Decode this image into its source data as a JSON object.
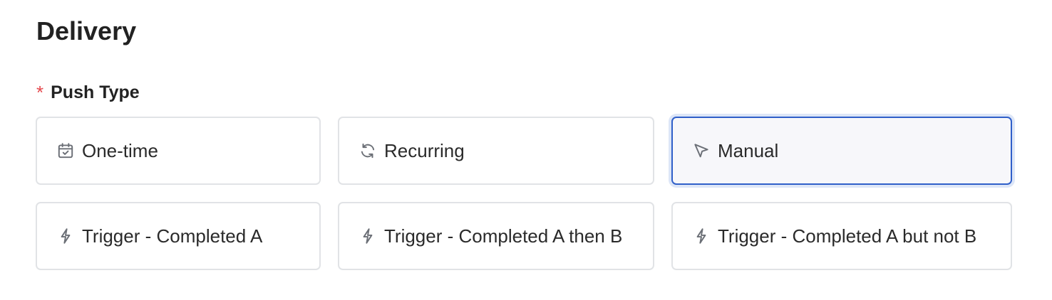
{
  "section": {
    "title": "Delivery"
  },
  "push_type": {
    "required_mark": "*",
    "label": "Push Type",
    "selected": "Manual",
    "options": [
      {
        "label": "One-time",
        "icon": "calendar-check-icon"
      },
      {
        "label": "Recurring",
        "icon": "refresh-icon"
      },
      {
        "label": "Manual",
        "icon": "cursor-pointer-icon"
      },
      {
        "label": "Trigger - Completed A",
        "icon": "lightning-icon"
      },
      {
        "label": "Trigger - Completed A then B",
        "icon": "lightning-icon"
      },
      {
        "label": "Trigger - Completed A but not B",
        "icon": "lightning-icon"
      }
    ]
  },
  "colors": {
    "selected_border": "#2f5fc9",
    "selected_ring": "#dde6f7",
    "required": "#e5484d",
    "option_border": "#e1e3e6"
  }
}
